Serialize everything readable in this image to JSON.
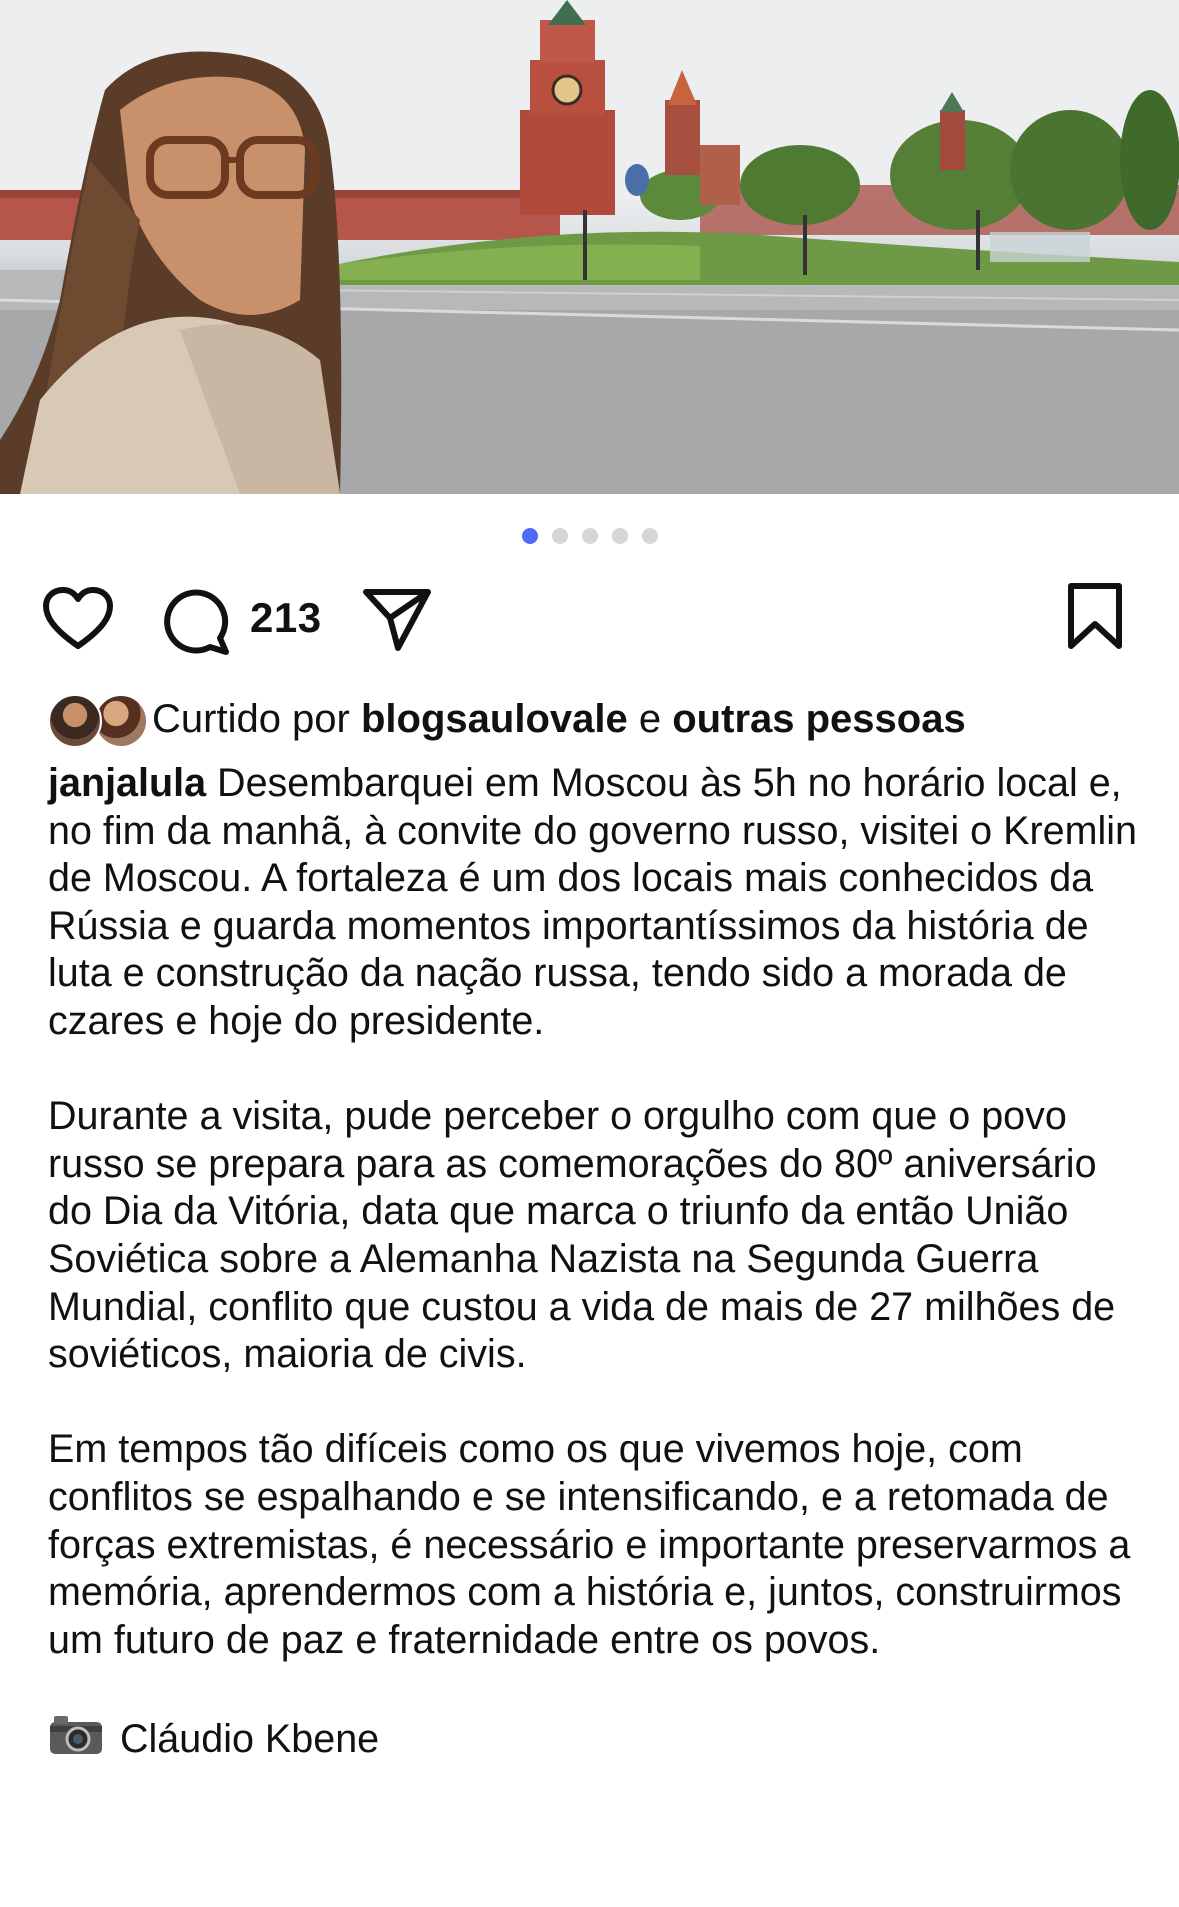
{
  "post": {
    "image": {
      "description_icon": "photo-icon",
      "carousel": {
        "total": 5,
        "active_index": 0
      }
    },
    "actions": {
      "like_icon": "heart-icon",
      "comment_icon": "comment-icon",
      "comment_count": "213",
      "share_icon": "send-icon",
      "save_icon": "bookmark-icon"
    },
    "likes": {
      "prefix": "Curtido por",
      "user": "blogsaulovale",
      "connector": "e",
      "others": "outras pessoas"
    },
    "caption": {
      "username": "janjalula",
      "paragraph1": "Desembarquei em Moscou às 5h no horário local e, no fim da manhã, à convite do governo russo, visitei o Kremlin de Moscou. A fortaleza é um dos locais mais conhecidos da Rússia e guarda momentos importantíssimos da história de luta e construção da nação russa, tendo sido a morada de czares e hoje do presidente.",
      "paragraph2": "Durante a visita, pude perceber o orgulho com que o povo russo se prepara para as comemorações do 80º aniversário do Dia da Vitória, data que marca o triunfo da então União Soviética sobre a Alemanha Nazista na Segunda Guerra Mundial, conflito que custou a vida de mais de 27 milhões de soviéticos, maioria de civis.",
      "paragraph3": "Em tempos tão difíceis como os que vivemos hoje, com conflitos se espalhando e se intensificando, e a retomada de forças extremistas, é necessário e importante preservarmos a memória, aprendermos com a história e, juntos, construirmos um futuro de paz e fraternidade entre os povos.",
      "credit_icon": "camera-icon",
      "credit": "Cláudio Kbene"
    },
    "colors": {
      "dot_active": "#4d6bf5",
      "dot_inactive": "#d6d6d6",
      "text": "#111111"
    }
  }
}
